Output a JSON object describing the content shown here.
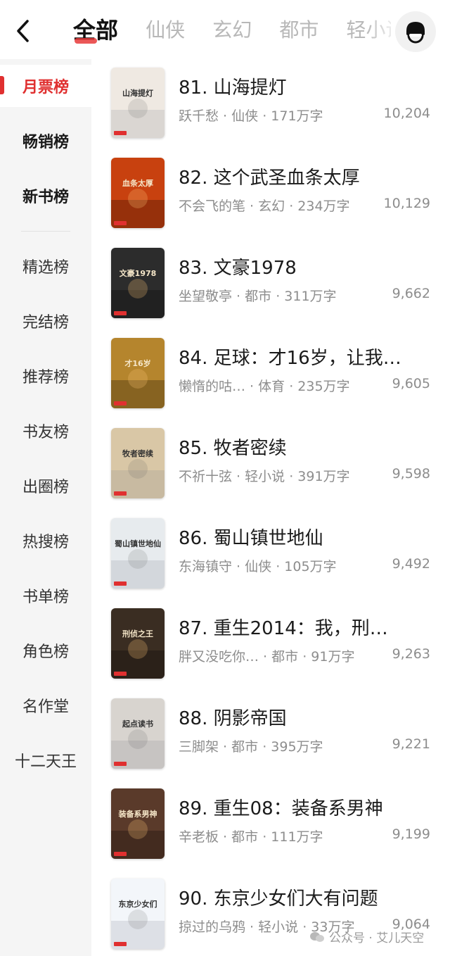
{
  "header": {
    "tabs": [
      "全部",
      "仙侠",
      "玄幻",
      "都市",
      "轻小说"
    ]
  },
  "sidebar": {
    "items": [
      "月票榜",
      "畅销榜",
      "新书榜",
      "精选榜",
      "完结榜",
      "推荐榜",
      "书友榜",
      "出圈榜",
      "热搜榜",
      "书单榜",
      "角色榜",
      "名作堂",
      "十二天王"
    ]
  },
  "books": [
    {
      "title": "81. 山海提灯",
      "author": "跃千愁",
      "genre": "仙侠",
      "words": "171万字",
      "votes": "10,204",
      "cover_text": "山海提灯",
      "cover_color": "#efe9e2"
    },
    {
      "title": "82. 这个武圣血条太厚",
      "author": "不会飞的笔",
      "genre": "玄幻",
      "words": "234万字",
      "votes": "10,129",
      "cover_text": "血条太厚",
      "cover_color": "#c8410f"
    },
    {
      "title": "83. 文豪1978",
      "author": "坐望敬亭",
      "genre": "都市",
      "words": "311万字",
      "votes": "9,662",
      "cover_text": "文豪1978",
      "cover_color": "#2c2c2c"
    },
    {
      "title": "84. 足球：才16岁，让我…",
      "author": "懒惰的咕…",
      "genre": "体育",
      "words": "235万字",
      "votes": "9,605",
      "cover_text": "才16岁",
      "cover_color": "#b5852d"
    },
    {
      "title": "85. 牧者密续",
      "author": "不祈十弦",
      "genre": "轻小说",
      "words": "391万字",
      "votes": "9,598",
      "cover_text": "牧者密续",
      "cover_color": "#d9c7a6"
    },
    {
      "title": "86. 蜀山镇世地仙",
      "author": "东海镇守",
      "genre": "仙侠",
      "words": "105万字",
      "votes": "9,492",
      "cover_text": "蜀山镇世地仙",
      "cover_color": "#e7ebee"
    },
    {
      "title": "87. 重生2014：我，刑…",
      "author": "胖又没吃你…",
      "genre": "都市",
      "words": "91万字",
      "votes": "9,263",
      "cover_text": "刑侦之王",
      "cover_color": "#3a2d22"
    },
    {
      "title": "88. 阴影帝国",
      "author": "三脚架",
      "genre": "都市",
      "words": "395万字",
      "votes": "9,221",
      "cover_text": "起点读书",
      "cover_color": "#d8d4cf"
    },
    {
      "title": "89. 重生08：装备系男神",
      "author": "辛老板",
      "genre": "都市",
      "words": "111万字",
      "votes": "9,199",
      "cover_text": "装备系男神",
      "cover_color": "#5a3a2a"
    },
    {
      "title": "90. 东京少女们大有问题",
      "author": "掠过的乌鸦",
      "genre": "轻小说",
      "words": "33万字",
      "votes": "9,064",
      "cover_text": "东京少女们",
      "cover_color": "#f3f6fa"
    }
  ],
  "watermark": {
    "text": "公众号 · 艾儿天空"
  },
  "colors": {
    "accent": "#e03030",
    "text_secondary": "#8d8d8d",
    "sidebar_bg": "#f5f5f5"
  }
}
